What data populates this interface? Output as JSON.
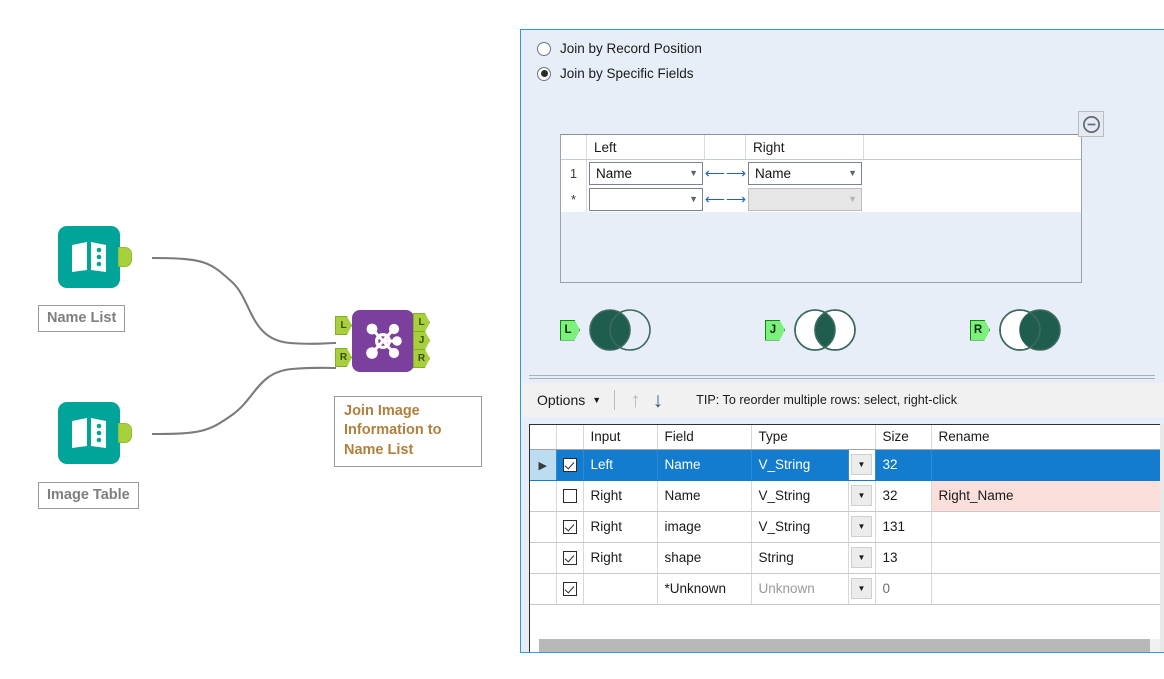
{
  "canvas": {
    "tools": [
      {
        "name": "Name List",
        "label": "Name List",
        "icon": "input-data-icon"
      },
      {
        "name": "Image Table",
        "label": "Image Table",
        "icon": "input-data-icon"
      }
    ],
    "join_tool": {
      "icon": "join-icon",
      "inputs": [
        "L",
        "R"
      ],
      "outputs": [
        "L",
        "J",
        "R"
      ]
    },
    "annotation": "Join Image Information to Name List"
  },
  "panel": {
    "join_mode": {
      "options": [
        {
          "label": "Join by Record Position",
          "selected": false
        },
        {
          "label": "Join by Specific Fields",
          "selected": true
        }
      ]
    },
    "mapping": {
      "headers": {
        "left": "Left",
        "right": "Right"
      },
      "rows": [
        {
          "num": "1",
          "left": "Name",
          "right": "Name",
          "right_disabled": false
        },
        {
          "num": "*",
          "left": "",
          "right": "",
          "right_disabled": true
        }
      ],
      "arrow_left": "←",
      "arrow_right": "→"
    },
    "remove_button": "remove-icon",
    "venn": [
      {
        "tag": "L",
        "name": "left-output-venn",
        "fill": "left"
      },
      {
        "tag": "J",
        "name": "join-output-venn",
        "fill": "center"
      },
      {
        "tag": "R",
        "name": "right-output-venn",
        "fill": "right"
      }
    ],
    "toolbar": {
      "options_label": "Options",
      "options_caret": "▾",
      "move_up": "↑",
      "move_down": "↓",
      "tip": "TIP: To reorder multiple rows: select, right-click"
    },
    "table": {
      "columns": [
        "",
        "",
        "Input",
        "Field",
        "Type",
        "",
        "Size",
        "Rename"
      ],
      "rows": [
        {
          "selected": true,
          "marker": "▶",
          "checked": true,
          "input": "Left",
          "field": "Name",
          "type": "V_String",
          "type_muted": false,
          "size": "32",
          "rename": "",
          "rename_highlight": false
        },
        {
          "selected": false,
          "marker": "",
          "checked": false,
          "input": "Right",
          "field": "Name",
          "type": "V_String",
          "type_muted": false,
          "size": "32",
          "rename": "Right_Name",
          "rename_highlight": true
        },
        {
          "selected": false,
          "marker": "",
          "checked": true,
          "input": "Right",
          "field": "image",
          "type": "V_String",
          "type_muted": false,
          "size": "131",
          "rename": "",
          "rename_highlight": false
        },
        {
          "selected": false,
          "marker": "",
          "checked": true,
          "input": "Right",
          "field": "shape",
          "type": "String",
          "type_muted": false,
          "size": "13",
          "rename": "",
          "rename_highlight": false
        },
        {
          "selected": false,
          "marker": "",
          "checked": true,
          "input": "",
          "field": "*Unknown",
          "type": "Unknown",
          "type_muted": true,
          "size": "0",
          "rename": "",
          "rename_highlight": false
        }
      ],
      "dropdown_glyph": "▼"
    }
  },
  "colors": {
    "panel_border": "#2e9ad6",
    "panel_bg": "#e8eef8",
    "row_selected": "#137cce",
    "venn_fill": "#1f5d4e",
    "input_tool": "#00a499",
    "join_tool": "#7b3f9d",
    "anchor": "#a8d03c",
    "rename_highlight": "#fbdfdb"
  }
}
